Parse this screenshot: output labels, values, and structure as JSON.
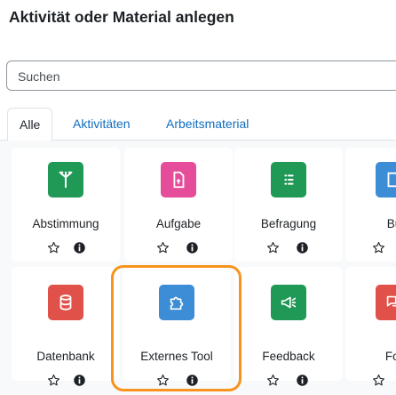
{
  "title": "Aktivität oder Material anlegen",
  "search": {
    "placeholder": "Suchen"
  },
  "tabs": [
    {
      "label": "Alle",
      "active": true
    },
    {
      "label": "Aktivitäten",
      "active": false
    },
    {
      "label": "Arbeitsmaterial",
      "active": false
    }
  ],
  "items": [
    {
      "label": "Abstimmung",
      "icon": "choice-icon",
      "color": "#1f9955"
    },
    {
      "label": "Aufgabe",
      "icon": "assignment-icon",
      "color": "#e54c9a"
    },
    {
      "label": "Befragung",
      "icon": "survey-icon",
      "color": "#1f9955"
    },
    {
      "label": "Bu",
      "icon": "book-icon",
      "color": "#3d8dd6"
    },
    {
      "label": "Datenbank",
      "icon": "database-icon",
      "color": "#e0514a"
    },
    {
      "label": "Externes Tool",
      "icon": "external-tool-icon",
      "color": "#3d8dd6"
    },
    {
      "label": "Feedback",
      "icon": "feedback-icon",
      "color": "#1f9955"
    },
    {
      "label": "For",
      "icon": "forum-icon",
      "color": "#e0514a"
    }
  ],
  "colors": {
    "accent": "#0f6cbf",
    "highlight": "#f7931e"
  }
}
